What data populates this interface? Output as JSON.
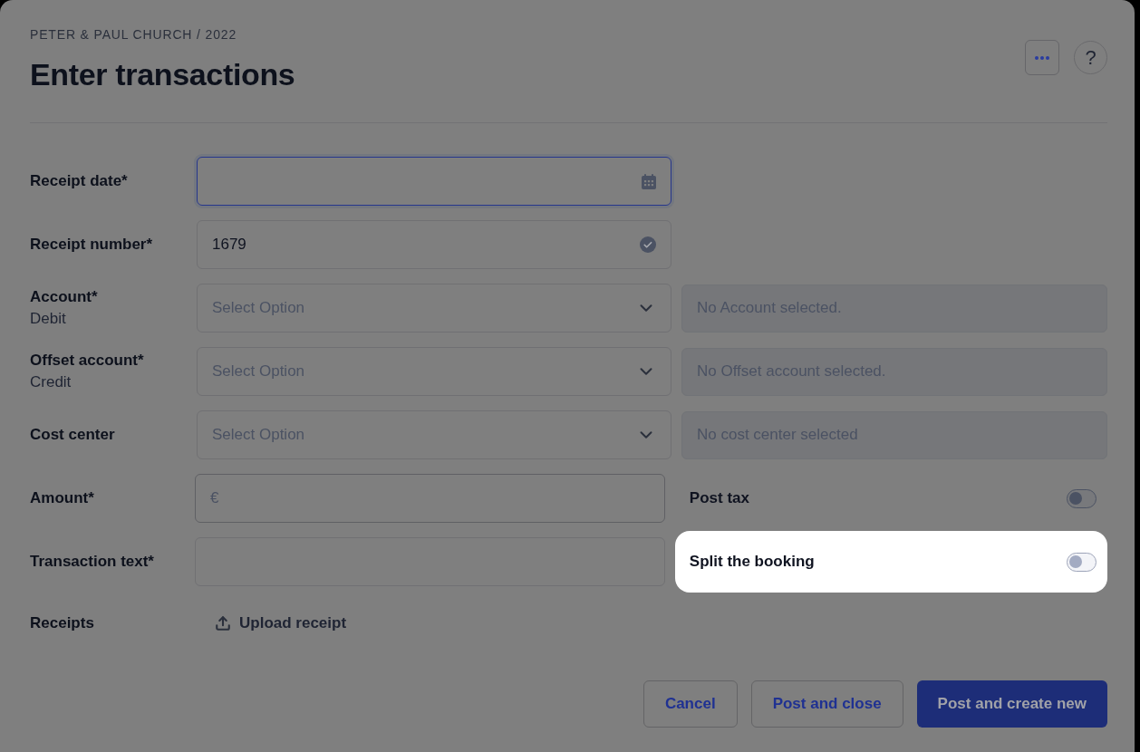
{
  "header": {
    "breadcrumb": "PETER & PAUL CHURCH / 2022",
    "title": "Enter transactions",
    "help_button": "?"
  },
  "fields": [
    {
      "kind": "date",
      "label": "Receipt date*",
      "focused": true
    },
    {
      "kind": "text",
      "label": "Receipt number*",
      "value": "1679",
      "valid": true
    },
    {
      "kind": "select",
      "label": "Account*",
      "sublabel": "Debit",
      "placeholder": "Select Option",
      "info": "No Account selected."
    },
    {
      "kind": "select",
      "label": "Offset account*",
      "sublabel": "Credit",
      "placeholder": "Select Option",
      "info": "No Offset account selected."
    },
    {
      "kind": "select",
      "label": "Cost center",
      "placeholder": "Select Option",
      "info": "No cost center selected"
    },
    {
      "kind": "currency",
      "label": "Amount*",
      "prefix": "€",
      "toggle": {
        "label": "Post tax",
        "on": false,
        "highlighted": false
      }
    },
    {
      "kind": "text",
      "label": "Transaction text*",
      "toggle": {
        "label": "Split the booking",
        "on": false,
        "highlighted": true
      }
    },
    {
      "kind": "upload",
      "label": "Receipts",
      "action": "Upload receipt"
    }
  ],
  "actions": [
    {
      "label": "Cancel",
      "primary": false
    },
    {
      "label": "Post and close",
      "primary": false
    },
    {
      "label": "Post and create new",
      "primary": true
    }
  ]
}
